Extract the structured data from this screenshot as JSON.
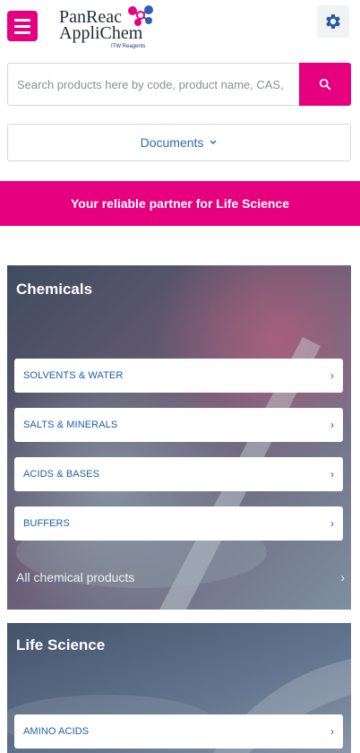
{
  "header": {
    "logo_line1": "PanReac",
    "logo_line2": "AppliChem",
    "logo_sub": "ITW Reagents",
    "menu_icon": "hamburger-icon",
    "settings_icon": "gear-icon",
    "accent_color": "#e6007e"
  },
  "search": {
    "placeholder": "Search products here by code, product name, CAS,",
    "value": "",
    "icon": "search-icon"
  },
  "documents": {
    "label": "Documents",
    "icon": "chevron-down-icon"
  },
  "banner": {
    "text": "Your reliable partner for Life Science"
  },
  "categories": [
    {
      "title": "Chemicals",
      "items": [
        {
          "label": "SOLVENTS & WATER",
          "chevron": "›"
        },
        {
          "label": "SALTS & MINERALS",
          "chevron": "›"
        },
        {
          "label": "ACIDS & BASES",
          "chevron": "›"
        },
        {
          "label": "BUFFERS",
          "chevron": "›"
        }
      ],
      "all_label": "All chemical products",
      "all_chevron": "›"
    },
    {
      "title": "Life Science",
      "items": [
        {
          "label": "AMINO ACIDS",
          "chevron": "›"
        }
      ]
    }
  ]
}
